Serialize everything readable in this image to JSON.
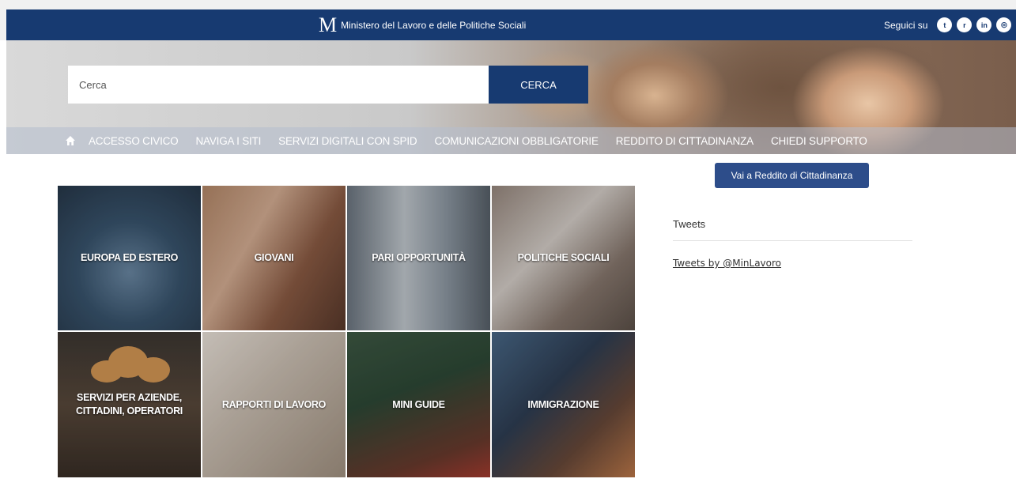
{
  "header": {
    "logo_text": "M",
    "site_name": "Ministero del Lavoro e delle Politiche Sociali",
    "follow_label": "Seguici su",
    "social": [
      {
        "icon": "twitter-icon",
        "glyph": "t"
      },
      {
        "icon": "rss-icon",
        "glyph": "r"
      },
      {
        "icon": "linkedin-icon",
        "glyph": "in"
      },
      {
        "icon": "instagram-icon",
        "glyph": "◎"
      }
    ],
    "bg_color": "#173a71"
  },
  "search": {
    "placeholder": "Cerca",
    "button_label": "CERCA"
  },
  "nav": {
    "items": [
      "ACCESSO CIVICO",
      "NAVIGA I SITI",
      "SERVIZI DIGITALI CON SPID",
      "COMUNICAZIONI OBBLIGATORIE",
      "REDDITO DI CITTADINANZA",
      "CHIEDI SUPPORTO"
    ]
  },
  "tiles": [
    "EUROPA ED ESTERO",
    "GIOVANI",
    "PARI OPPORTUNITÀ",
    "POLITICHE SOCIALI",
    "SERVIZI PER AZIENDE, CITTADINI, OPERATORI",
    "RAPPORTI DI LAVORO",
    "MINI GUIDE",
    "IMMIGRAZIONE"
  ],
  "sidebar": {
    "rdc_button": "Vai a Reddito di Cittadinanza",
    "tweets_title": "Tweets",
    "tweets_link": "Tweets by @MinLavoro"
  }
}
